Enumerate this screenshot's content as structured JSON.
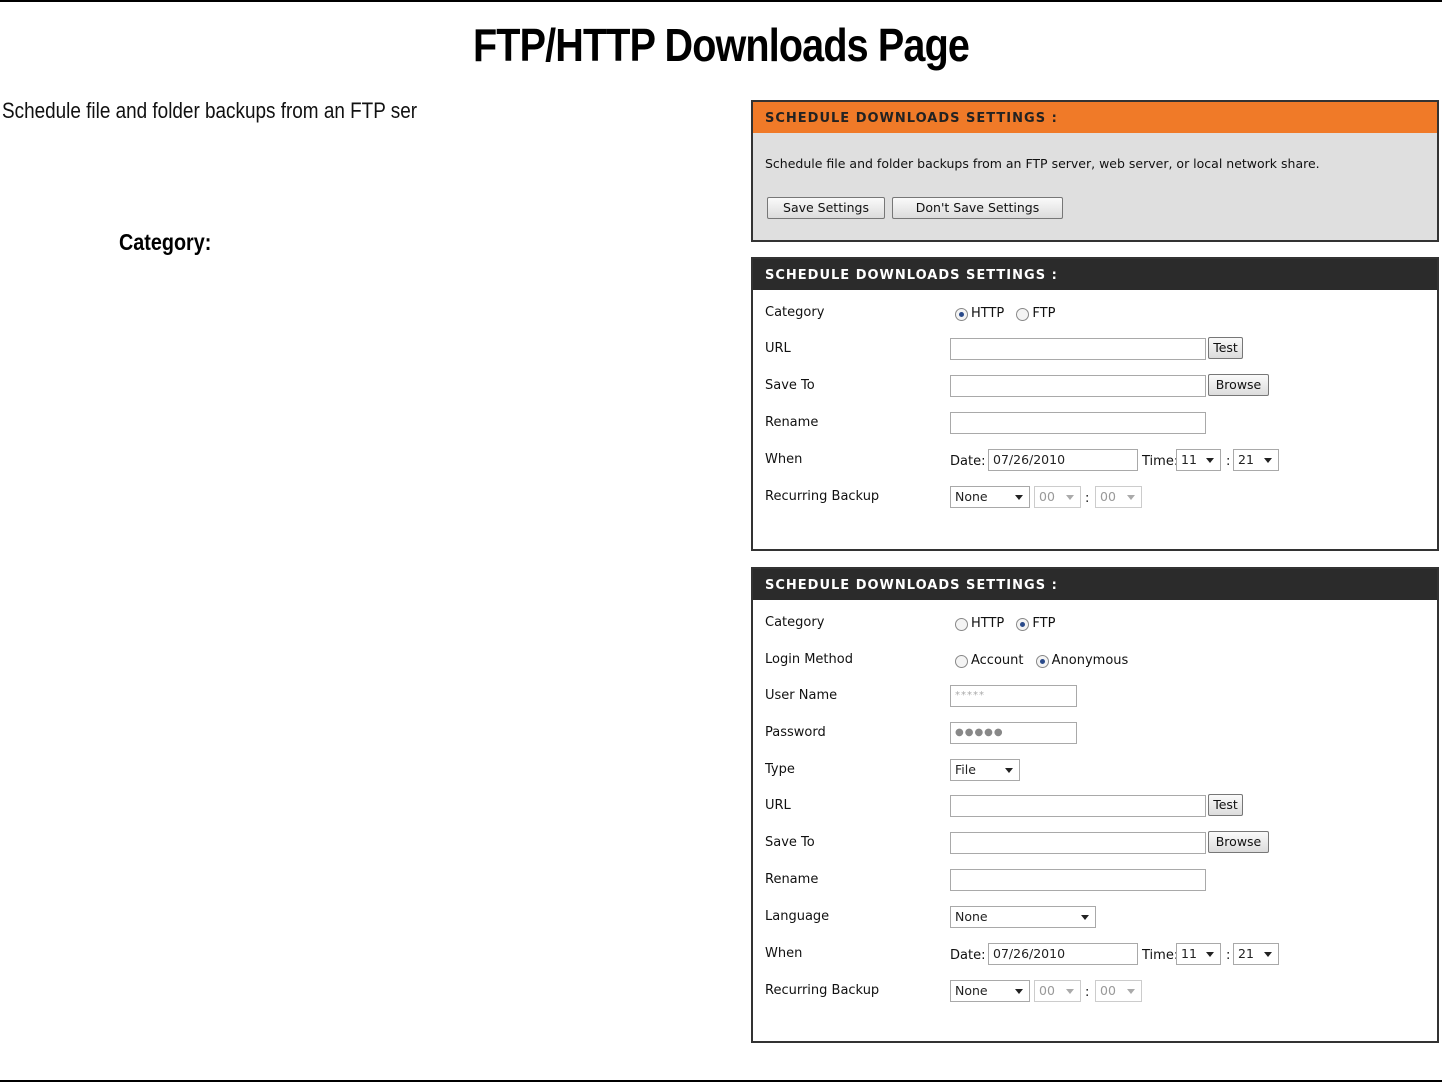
{
  "page": {
    "title": "FTP/HTTP Downloads Page",
    "intro": "Schedule file and folder backups from an FTP ser",
    "category_heading": "Category:"
  },
  "panel_top": {
    "header": "SCHEDULE DOWNLOADS SETTINGS :",
    "description": "Schedule file and folder backups from an FTP server, web server, or local network share.",
    "save_label": "Save Settings",
    "dont_save_label": "Don't Save Settings"
  },
  "panel_http": {
    "header": "SCHEDULE DOWNLOADS SETTINGS :",
    "category_label": "Category",
    "category_options": [
      "HTTP",
      "FTP"
    ],
    "category_selected": "HTTP",
    "url_label": "URL",
    "url_value": "",
    "test_label": "Test",
    "save_to_label": "Save To",
    "save_to_value": "",
    "browse_label": "Browse",
    "rename_label": "Rename",
    "rename_value": "",
    "when_label": "When",
    "date_label": "Date:",
    "date_value": "07/26/2010",
    "time_label": "Time:",
    "time_hour": "11",
    "time_sep": ":",
    "time_minute": "21",
    "recurring_label": "Recurring Backup",
    "recurring_value": "None",
    "recurring_hour": "00",
    "recurring_sep": ":",
    "recurring_minute": "00"
  },
  "panel_ftp": {
    "header": "SCHEDULE DOWNLOADS SETTINGS :",
    "category_label": "Category",
    "category_options": [
      "HTTP",
      "FTP"
    ],
    "category_selected": "FTP",
    "login_label": "Login Method",
    "login_options": [
      "Account",
      "Anonymous"
    ],
    "login_selected": "Anonymous",
    "username_label": "User Name",
    "username_value": "*****",
    "password_label": "Password",
    "password_value": "●●●●●",
    "type_label": "Type",
    "type_value": "File",
    "url_label": "URL",
    "url_value": "",
    "test_label": "Test",
    "save_to_label": "Save To",
    "save_to_value": "",
    "browse_label": "Browse",
    "rename_label": "Rename",
    "rename_value": "",
    "language_label": "Language",
    "language_value": "None",
    "when_label": "When",
    "date_label": "Date:",
    "date_value": "07/26/2010",
    "time_label": "Time:",
    "time_hour": "11",
    "time_sep": ":",
    "time_minute": "21",
    "recurring_label": "Recurring Backup",
    "recurring_value": "None",
    "recurring_hour": "00",
    "recurring_sep": ":",
    "recurring_minute": "00"
  },
  "colors": {
    "orange_header": "#f07a28",
    "dark_header": "#2b2b2b",
    "panel_gray": "#dfdfdf"
  }
}
